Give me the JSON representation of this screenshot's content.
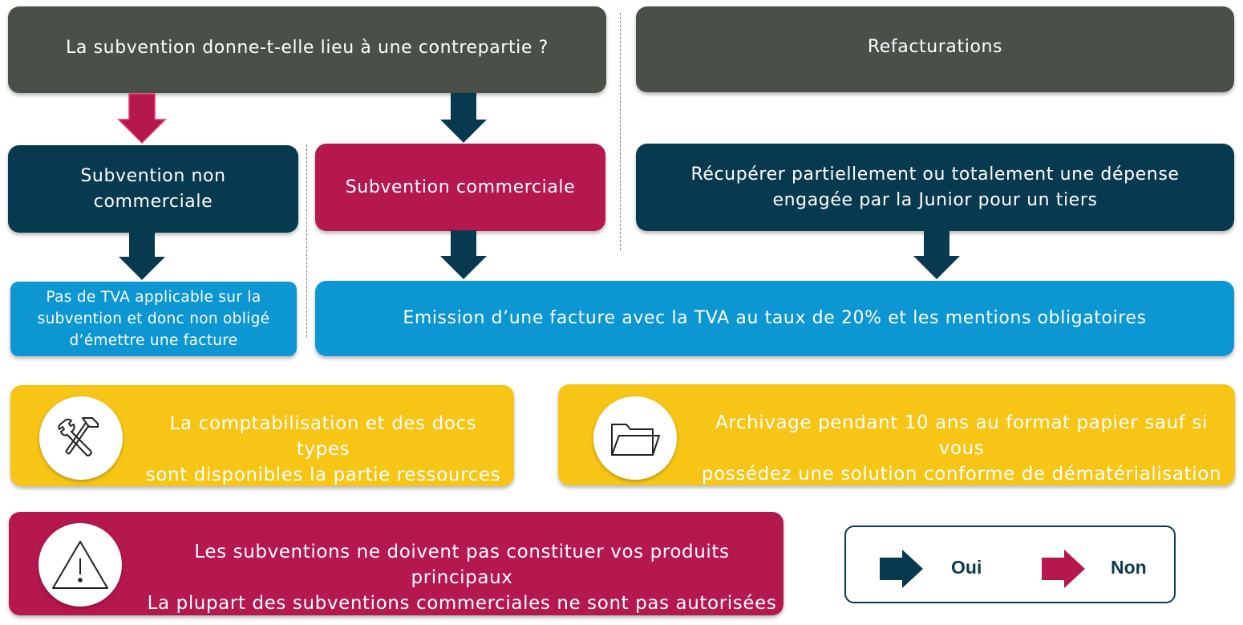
{
  "colors": {
    "grey": "#4a4f48",
    "navy": "#083a4f",
    "crimson": "#b5174f",
    "blue": "#0c96d2",
    "yellow": "#f7c516"
  },
  "header": {
    "question": "La subvention donne-t-elle lieu à une contrepartie ?",
    "refacturations": "Refacturations"
  },
  "middle": {
    "non_commerciale_line1": "Subvention non",
    "non_commerciale_line2": "commerciale",
    "commerciale": "Subvention commerciale",
    "recuperer_line1": "Récupérer partiellement ou totalement une dépense",
    "recuperer_line2": "engagée par la Junior pour un tiers"
  },
  "bottom": {
    "pas_tva_line1": "Pas de TVA applicable sur la",
    "pas_tva_line2": "subvention et donc non obligé",
    "pas_tva_line3": "d’émettre une facture",
    "emission": "Emission d’une facture avec la TVA au taux de 20% et les mentions obligatoires"
  },
  "info": {
    "comptabilisation_line1": "La comptabilisation et des docs types",
    "comptabilisation_line2": "sont disponibles la partie ressources",
    "comptabilisation_icon": "hammer-wrench-icon",
    "archivage_line1": "Archivage pendant 10 ans au format papier sauf si vous",
    "archivage_line2": "possédez une solution conforme de dématérialisation",
    "archivage_icon": "folder-icon",
    "warning_line1": "Les subventions ne doivent pas constituer vos produits principaux",
    "warning_line2": "La plupart des subventions commerciales ne sont pas autorisées",
    "warning_icon": "warning-icon"
  },
  "legend": {
    "oui": "Oui",
    "non": "Non"
  }
}
